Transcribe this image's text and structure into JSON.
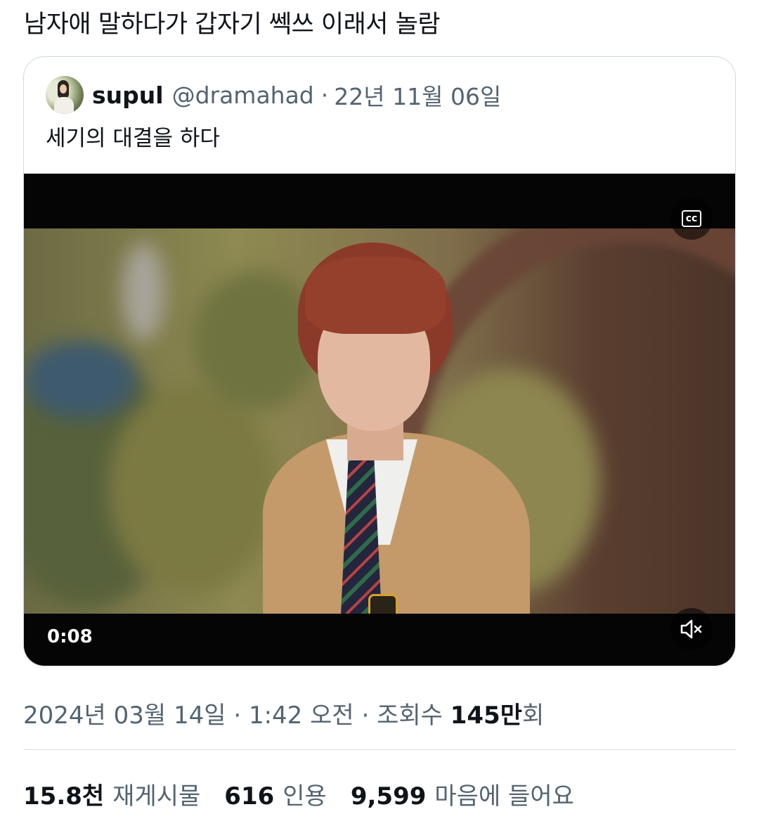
{
  "post": {
    "text": "남자애 말하다가 갑자기 쎅쓰 이래서 놀람"
  },
  "quoted_post": {
    "author_name": "supul",
    "handle": "@dramahad",
    "separator": "·",
    "date": "22년 11월 06일",
    "text": "세기의 대결을 하다",
    "video": {
      "cc_label": "cc",
      "elapsed_time": "0:08",
      "muted": true
    }
  },
  "meta": {
    "date": "2024년 03월 14일",
    "time": "1:42 오전",
    "views_label": "조회수",
    "views_value": "145만",
    "views_suffix": "회",
    "separator": "·"
  },
  "stats": {
    "reposts_value": "15.8천",
    "reposts_label": "재게시물",
    "quotes_value": "616",
    "quotes_label": "인용",
    "likes_value": "9,599",
    "likes_label": "마음에 들어요"
  }
}
